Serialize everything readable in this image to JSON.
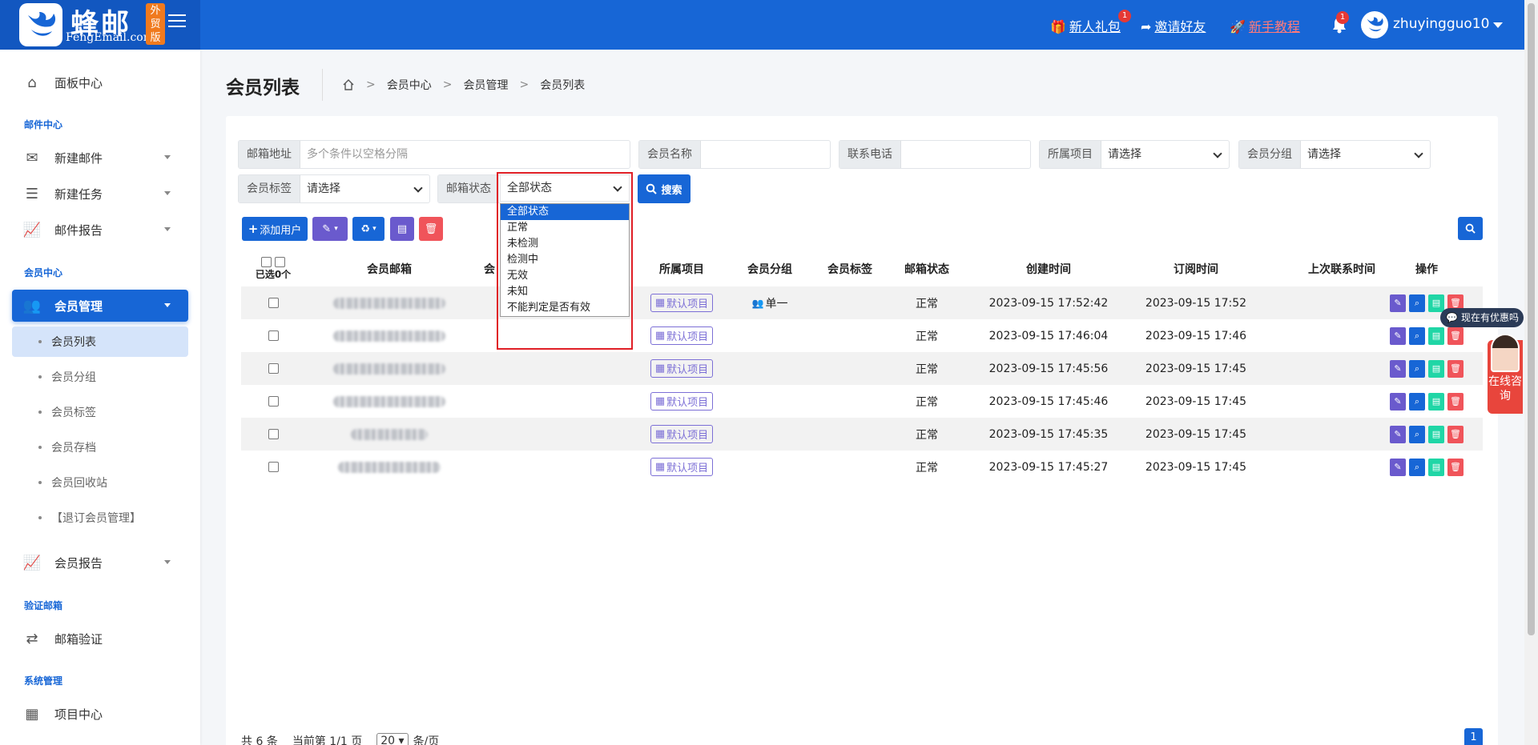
{
  "header": {
    "logo_cn": "蜂邮",
    "logo_en": "FengEmail.com",
    "logo_badge": "外贸版",
    "links": [
      {
        "label": "新人礼包",
        "badge": "1"
      },
      {
        "label": "邀请好友"
      },
      {
        "label": "新手教程"
      }
    ],
    "bell_badge": "1",
    "username": "zhuyingguo10"
  },
  "sidebar": {
    "dashboard": "面板中心",
    "section_mail": "邮件中心",
    "new_mail": "新建邮件",
    "new_task": "新建任务",
    "mail_report": "邮件报告",
    "section_member": "会员中心",
    "member_mgmt": "会员管理",
    "subs": [
      "会员列表",
      "会员分组",
      "会员标签",
      "会员存档",
      "会员回收站",
      "【退订会员管理】"
    ],
    "member_report": "会员报告",
    "section_verify": "验证邮箱",
    "mail_verify": "邮箱验证",
    "section_system": "系统管理",
    "project_center": "项目中心"
  },
  "page": {
    "title": "会员列表",
    "breadcrumb": [
      "会员中心",
      "会员管理",
      "会员列表"
    ]
  },
  "filters": {
    "email_label": "邮箱地址",
    "email_placeholder": "多个条件以空格分隔",
    "name_label": "会员名称",
    "phone_label": "联系电话",
    "project_label": "所属项目",
    "project_value": "请选择",
    "group_label": "会员分组",
    "group_value": "请选择",
    "tag_label": "会员标签",
    "tag_value": "请选择",
    "status_label": "邮箱状态",
    "status_value": "全部状态",
    "search": "搜索"
  },
  "dropdown": {
    "options": [
      "全部状态",
      "正常",
      "未检测",
      "检测中",
      "无效",
      "未知",
      "不能判定是否有效"
    ],
    "selected_index": 0
  },
  "toolbar": {
    "add_user": "添加用户"
  },
  "table": {
    "selected_label": "已选0个",
    "headers": [
      "会员邮箱",
      "会",
      "所属项目",
      "会员分组",
      "会员标签",
      "邮箱状态",
      "创建时间",
      "订阅时间",
      "上次联系时间",
      "操作"
    ],
    "rows": [
      {
        "project": "默认项目",
        "group": "单一",
        "status": "正常",
        "created": "2023-09-15 17:52:42",
        "subscribed": "2023-09-15 17:52"
      },
      {
        "project": "默认项目",
        "group": "",
        "status": "正常",
        "created": "2023-09-15 17:46:04",
        "subscribed": "2023-09-15 17:46"
      },
      {
        "project": "默认项目",
        "group": "",
        "status": "正常",
        "created": "2023-09-15 17:45:56",
        "subscribed": "2023-09-15 17:45"
      },
      {
        "project": "默认项目",
        "group": "",
        "status": "正常",
        "created": "2023-09-15 17:45:46",
        "subscribed": "2023-09-15 17:45"
      },
      {
        "project": "默认项目",
        "group": "",
        "status": "正常",
        "created": "2023-09-15 17:45:35",
        "subscribed": "2023-09-15 17:45"
      },
      {
        "project": "默认项目",
        "group": "",
        "status": "正常",
        "created": "2023-09-15 17:45:27",
        "subscribed": "2023-09-15 17:45"
      }
    ]
  },
  "pager": {
    "total": "共 6 条",
    "current": "当前第 1/1 页",
    "page_size": "20",
    "per": "条/页",
    "page": "1"
  },
  "widgets": {
    "coupon": "现在有优惠吗",
    "consult": "在线咨询"
  },
  "colors": {
    "primary": "#1766d6",
    "edit": "#6a5acd",
    "archive": "#20d6a6",
    "delete": "#f0545a",
    "highlight": "#e01f26"
  }
}
